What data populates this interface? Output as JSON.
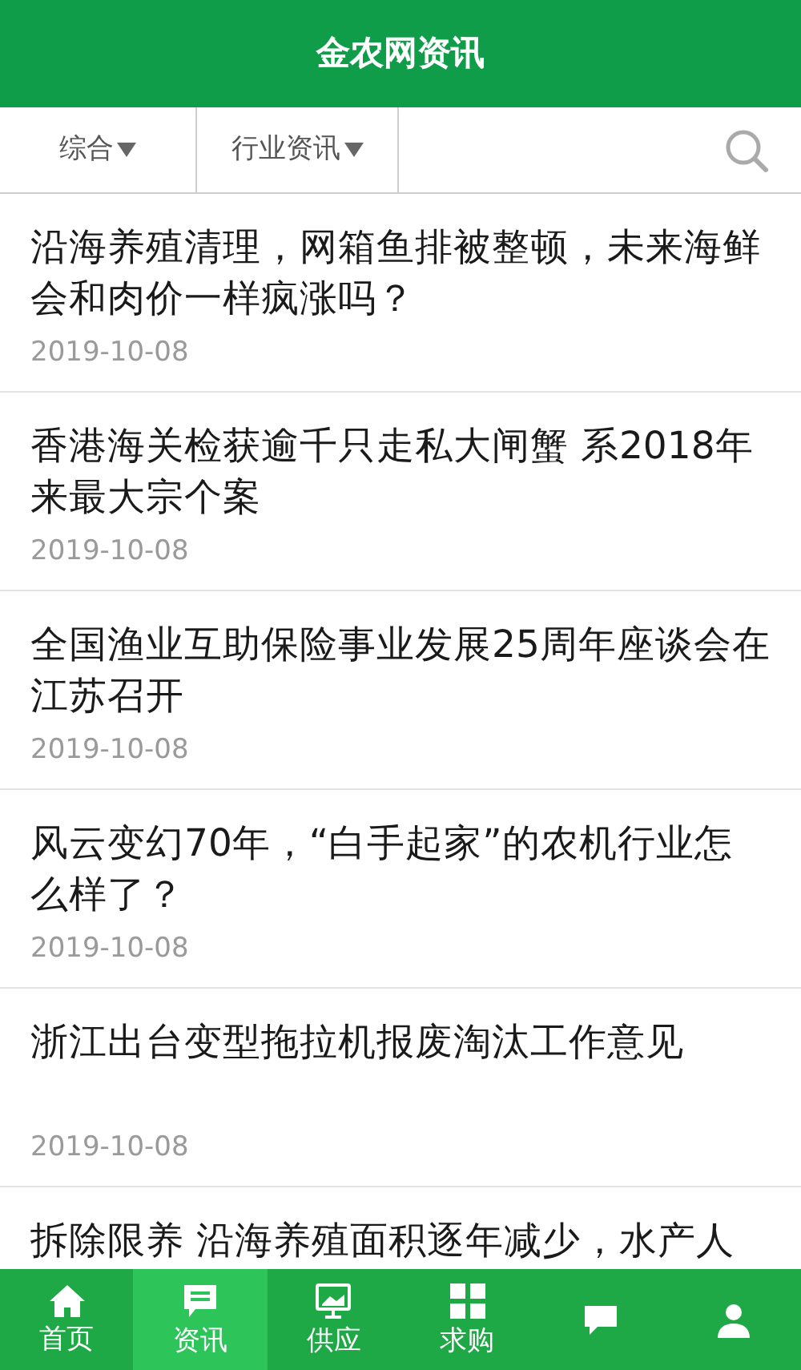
{
  "header": {
    "title": "金农网资讯"
  },
  "filters": [
    {
      "label": "综合"
    },
    {
      "label": "行业资讯"
    }
  ],
  "news": [
    {
      "title": "沿海养殖清理，网箱鱼排被整顿，未来海鲜会和肉价一样疯涨吗？",
      "date": "2019-10-08"
    },
    {
      "title": "香港海关检获逾千只走私大闸蟹 系2018年来最大宗个案",
      "date": "2019-10-08"
    },
    {
      "title": "全国渔业互助保险事业发展25周年座谈会在江苏召开",
      "date": "2019-10-08"
    },
    {
      "title": "风云变幻70年，“白手起家”的农机行业怎么样了？",
      "date": "2019-10-08"
    },
    {
      "title": "浙江出台变型拖拉机报废淘汰工作意见",
      "date": "2019-10-08"
    },
    {
      "title": "拆除限养 沿海养殖面积逐年减少，水产人"
    }
  ],
  "nav": [
    {
      "kind": "home",
      "label": "首页",
      "selected": false
    },
    {
      "kind": "news",
      "label": "资讯",
      "selected": true
    },
    {
      "kind": "supply",
      "label": "供应",
      "selected": false
    },
    {
      "kind": "grid",
      "label": "求购",
      "selected": false
    },
    {
      "kind": "chat",
      "selected": false
    },
    {
      "kind": "person",
      "selected": false
    }
  ]
}
